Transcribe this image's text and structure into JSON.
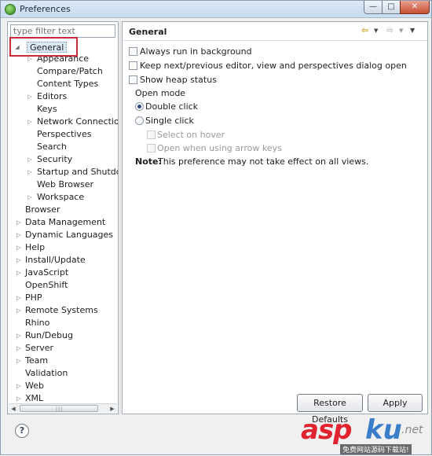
{
  "window": {
    "title": "Preferences"
  },
  "filter": {
    "placeholder": "type filter text"
  },
  "tree": {
    "general": "General",
    "general_children": [
      "Appearance",
      "Compare/Patch",
      "Content Types",
      "Editors",
      "Keys",
      "Network Connections",
      "Perspectives",
      "Search",
      "Security",
      "Startup and Shutdown",
      "Web Browser",
      "Workspace"
    ],
    "top_level": [
      "Browser",
      "Data Management",
      "Dynamic Languages",
      "Help",
      "Install/Update",
      "JavaScript",
      "OpenShift",
      "PHP",
      "Remote Systems",
      "Rhino",
      "Run/Debug",
      "Server",
      "Team",
      "Validation",
      "Web",
      "XML"
    ]
  },
  "page": {
    "title": "General",
    "always_run_background": "Always run in background",
    "keep_next_prev": "Keep next/previous editor, view and perspectives dialog open",
    "show_heap": "Show heap status",
    "open_mode_label": "Open mode",
    "double_click": "Double click",
    "single_click": "Single click",
    "select_on_hover": "Select on hover",
    "open_arrow_keys": "Open when using arrow keys",
    "note_bold": "Note:",
    "note_text": "This preference may not take effect on all views."
  },
  "buttons": {
    "restore_defaults": "Restore Defaults",
    "apply": "Apply"
  },
  "icons": {
    "help": "?"
  },
  "watermark": {
    "asp": "asp",
    "ku": "ku",
    "net": ".net",
    "sub": "免费网站源码下载站!"
  }
}
